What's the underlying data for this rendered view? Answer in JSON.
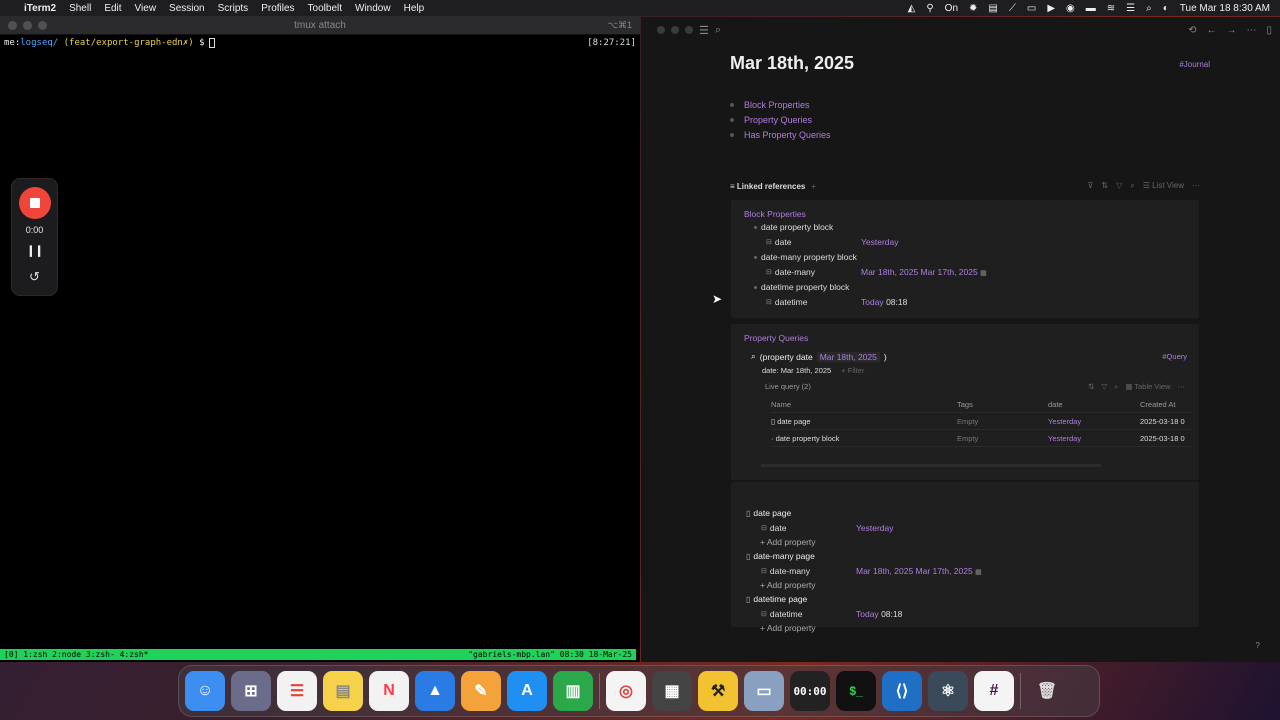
{
  "menubar": {
    "app": "iTerm2",
    "items": [
      "Shell",
      "Edit",
      "View",
      "Session",
      "Scripts",
      "Profiles",
      "Toolbelt",
      "Window",
      "Help"
    ],
    "status_on": "On",
    "datetime": "Tue Mar 18  8:30 AM"
  },
  "iterm": {
    "title": "tmux attach",
    "shortcut": "⌥⌘1",
    "prompt_user": "me:",
    "prompt_path": "logseq/",
    "prompt_branch": "(feat/export-graph-edn✗)",
    "prompt_symbol": "$",
    "clock": "[8:27:21]",
    "tmux_windows": "[0] 1:zsh  2:node  3:zsh- 4:zsh*",
    "tmux_right": "\"gabriels-mbp.lan\" 08:30 18-Mar-25"
  },
  "recorder": {
    "time": "0:00"
  },
  "logseq": {
    "page_title": "Mar 18th, 2025",
    "journal_tag": "#Journal",
    "top_blocks": [
      "Block Properties",
      "Property Queries",
      "Has Property Queries"
    ],
    "linked_refs_label": "Linked references",
    "list_view_label": "List View",
    "card1": {
      "title": "Block Properties",
      "blocks": [
        {
          "name": "date property block",
          "prop": "date",
          "value": "Yesterday",
          "extra": ""
        },
        {
          "name": "date-many property block",
          "prop": "date-many",
          "value": "Mar 18th, 2025 Mar 17th, 2025",
          "extra": ""
        },
        {
          "name": "datetime property block",
          "prop": "datetime",
          "value": "Today",
          "extra": "08:18"
        }
      ]
    },
    "card2": {
      "title": "Property Queries",
      "query_prefix": "(property date",
      "query_date": "Mar 18th, 2025",
      "query_suffix": ")",
      "query_tag": "#Query",
      "filter_text": "date: Mar 18th, 2025",
      "filter_btn": "+ Filter",
      "live_query": "Live query (2)",
      "table_view": "Table View",
      "columns": [
        "Name",
        "Tags",
        "date",
        "Created At"
      ],
      "rows": [
        {
          "name": "date page",
          "tags": "Empty",
          "date": "Yesterday",
          "created": "2025-03-18 0"
        },
        {
          "name": "date property block",
          "tags": "Empty",
          "date": "Yesterday",
          "created": "2025-03-18 0"
        }
      ]
    },
    "card3": {
      "add_property": "+ Add property",
      "pages": [
        {
          "name": "date page",
          "prop": "date",
          "value": "Yesterday",
          "extra": ""
        },
        {
          "name": "date-many page",
          "prop": "date-many",
          "value": "Mar 18th, 2025 Mar 17th, 2025",
          "extra": ""
        },
        {
          "name": "datetime page",
          "prop": "datetime",
          "value": "Today",
          "extra": "08:18"
        }
      ]
    },
    "help": "?"
  },
  "dock": {
    "clock_text": "00:00"
  },
  "colors": {
    "accent": "#b07ee0",
    "tmux_green": "#1fd25a",
    "record_red": "#f0453a"
  }
}
